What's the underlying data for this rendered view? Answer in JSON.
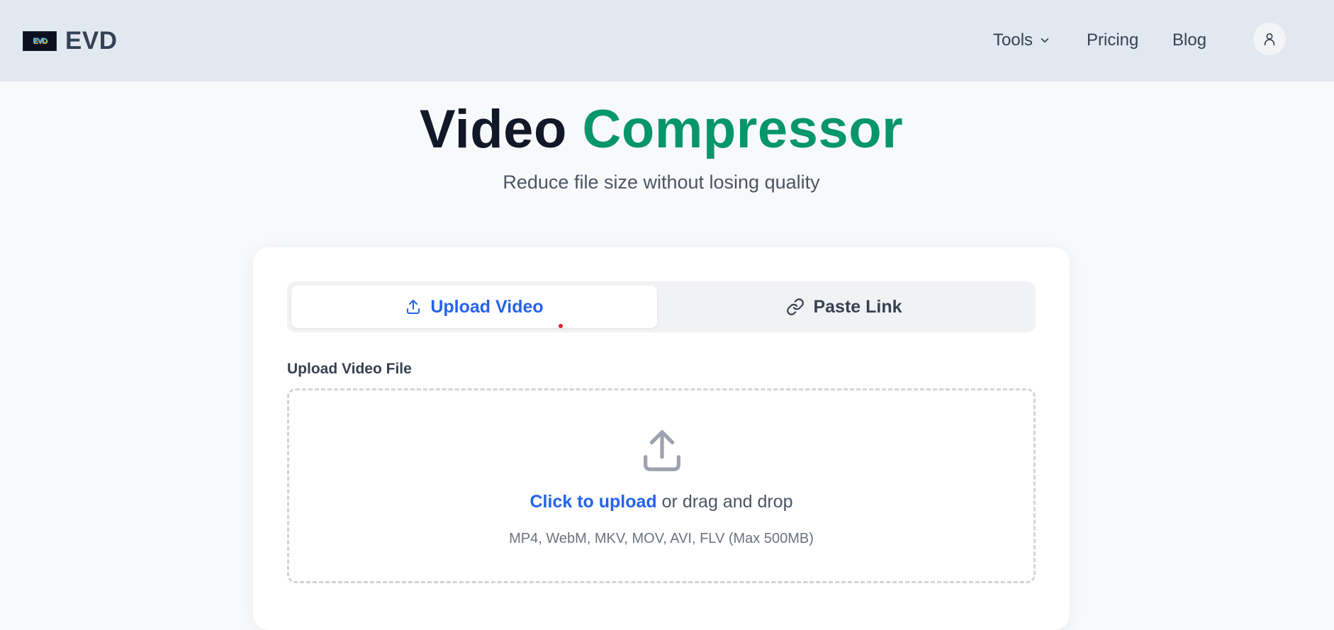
{
  "header": {
    "logo_image_text": "EVD",
    "logo_text": "EVD",
    "nav": {
      "tools": "Tools",
      "pricing": "Pricing",
      "blog": "Blog"
    }
  },
  "hero": {
    "title_part1": "Video",
    "title_part2": "Compressor",
    "subtitle": "Reduce file size without losing quality"
  },
  "tabs": {
    "upload": "Upload Video",
    "link": "Paste Link",
    "active": "upload"
  },
  "upload": {
    "label": "Upload Video File",
    "click_text": "Click to upload",
    "drag_text": "or drag and drop",
    "hint": "MP4, WebM, MKV, MOV, AVI, FLV (Max 500MB)"
  },
  "colors": {
    "accent_blue": "#2563eb",
    "accent_green": "#059669",
    "header_bg": "#e2e8f0"
  }
}
